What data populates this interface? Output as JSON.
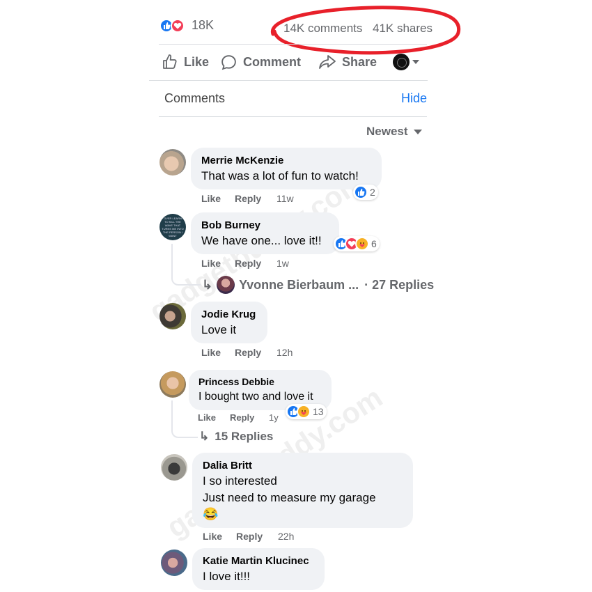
{
  "post_stats": {
    "reaction_count": "18K",
    "comments_count": "14K comments",
    "shares_count": "41K shares"
  },
  "actions": {
    "like": "Like",
    "comment": "Comment",
    "share": "Share"
  },
  "comments_header": {
    "title": "Comments",
    "hide": "Hide",
    "sort": "Newest"
  },
  "meta_labels": {
    "like": "Like",
    "reply": "Reply"
  },
  "comments": [
    {
      "name": "Merrie McKenzie",
      "text": "That was a lot of fun to watch!",
      "time": "11w",
      "reactions": "2"
    },
    {
      "name": "Bob Burney",
      "text": "We have one... love it!!",
      "time": "1w",
      "reactions": "6",
      "reply_preview": {
        "name": "Yvonne Bierbaum ...",
        "count": "· 27 Replies"
      },
      "avatar_text": "OVER LEARN TO KILL THE WAVE THAT TURNS ME INTO THE PERSON I WANT"
    },
    {
      "name": "Jodie Krug",
      "text": "Love it",
      "time": "12h"
    },
    {
      "name": "Princess Debbie",
      "text": "I bought two and love it",
      "time": "1y",
      "reactions": "13",
      "replies": "15 Replies"
    },
    {
      "name": "Dalia Britt",
      "text_lines": [
        "I so interested",
        "Just need to measure my garage"
      ],
      "emoji": "😂",
      "time": "22h"
    },
    {
      "name": "Katie Martin Klucinec",
      "text": "I love it!!!"
    }
  ],
  "watermark": "gadgetbuddy.com",
  "colors": {
    "brand_blue": "#1877f2",
    "love_red": "#f33e58",
    "annotation_red": "#e8202a",
    "bubble_gray": "#f0f2f5",
    "text_gray": "#65676b"
  }
}
